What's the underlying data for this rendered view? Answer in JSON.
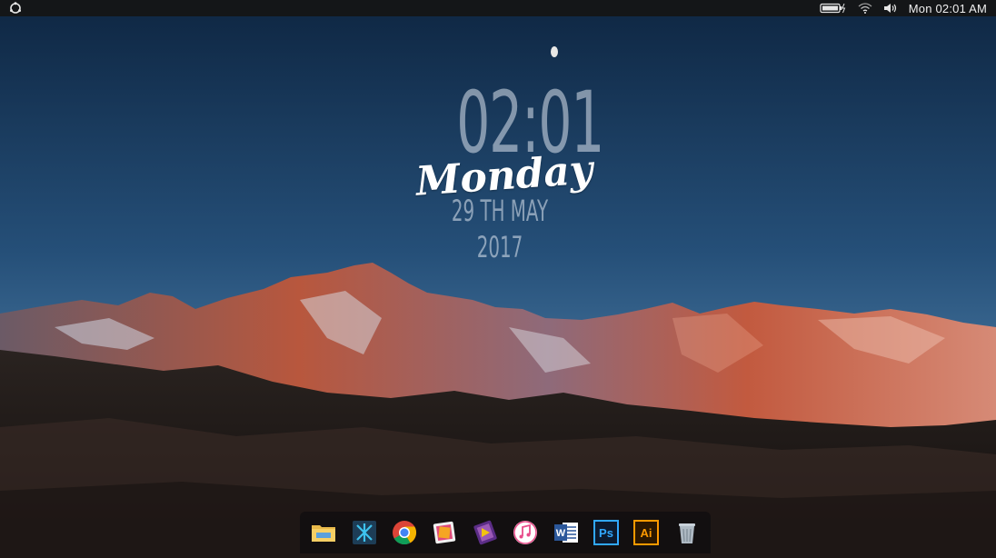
{
  "topbar": {
    "menu_icon": "ubuntu-circle-icon",
    "clock": "Mon 02:01 AM",
    "tray_icons": [
      "battery-charging-icon",
      "wifi-icon",
      "volume-icon"
    ]
  },
  "widget": {
    "time": "02:01",
    "day": "Monday",
    "date": "29 TH MAY 2017"
  },
  "dock": {
    "apps": [
      {
        "name": "Files",
        "icon": "folder-icon"
      },
      {
        "name": "App Launcher",
        "icon": "launcher-icon"
      },
      {
        "name": "Chrome",
        "icon": "chrome-icon"
      },
      {
        "name": "Photos",
        "icon": "photos-icon"
      },
      {
        "name": "Video Editor",
        "icon": "film-icon"
      },
      {
        "name": "iTunes",
        "icon": "music-icon"
      },
      {
        "name": "Word",
        "icon": "word-icon"
      },
      {
        "name": "Photoshop",
        "icon": "photoshop-icon"
      },
      {
        "name": "Illustrator",
        "icon": "illustrator-icon"
      },
      {
        "name": "Trash",
        "icon": "trash-icon"
      }
    ],
    "labels": {
      "photoshop": "Ps",
      "illustrator": "Ai",
      "word": "W"
    }
  },
  "colors": {
    "sky_top": "#0f2a4a",
    "sky_bottom": "#3f6f9a",
    "topbar": "#141618",
    "alpenglow": "#c8553a"
  }
}
